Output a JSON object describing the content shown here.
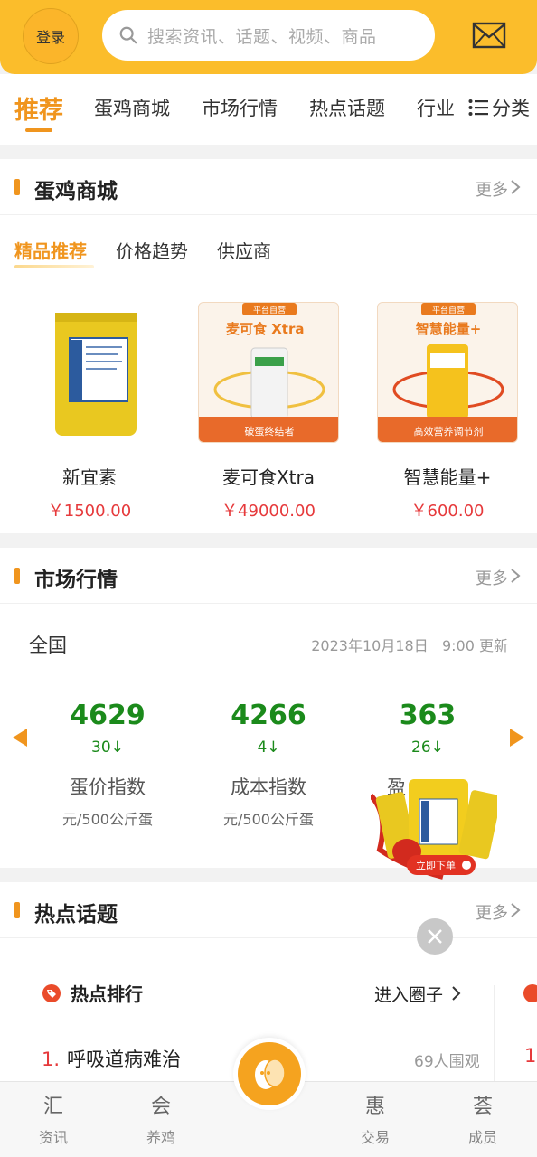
{
  "header": {
    "login_label": "登录",
    "search_placeholder": "搜索资讯、话题、视频、商品"
  },
  "nav": {
    "tabs": [
      "推荐",
      "蛋鸡商城",
      "市场行情",
      "热点话题",
      "行业"
    ],
    "category_label": "分类"
  },
  "mall": {
    "title": "蛋鸡商城",
    "more": "更多",
    "sub_tabs": [
      "精品推荐",
      "价格趋势",
      "供应商"
    ],
    "products": [
      {
        "name": "新宜素",
        "price": "￥1500.00"
      },
      {
        "name": "麦可食Xtra",
        "price": "￥49000.00",
        "badge": "平台自营",
        "caption": "破蛋终结者"
      },
      {
        "name": "智慧能量+",
        "price": "￥600.00",
        "badge": "平台自营",
        "caption": "高效营养调节剂"
      }
    ]
  },
  "market": {
    "title": "市场行情",
    "more": "更多",
    "region": "全国",
    "date": "2023年10月18日",
    "update": "9:00 更新",
    "indices": [
      {
        "value": "4629",
        "change": "30↓",
        "name": "蛋价指数",
        "unit": "元/500公斤蛋"
      },
      {
        "value": "4266",
        "change": "4↓",
        "name": "成本指数",
        "unit": "元/500公斤蛋"
      },
      {
        "value": "363",
        "change": "26↓",
        "name": "盈",
        "unit": ""
      }
    ]
  },
  "hot": {
    "title": "热点话题",
    "more": "更多",
    "ranking_title": "热点排行",
    "enter_circle": "进入圈子",
    "items": [
      {
        "rank": "1.",
        "text": "呼吸道病难治",
        "count": "69人围观"
      }
    ]
  },
  "promo": {
    "button": "立即下单"
  },
  "tabbar": {
    "items": [
      "资讯",
      "养鸡",
      "交易",
      "成员"
    ]
  },
  "colors": {
    "brand": "#fbbd2b",
    "accent": "#f0951e",
    "price": "#e6393b",
    "index": "#1b8a1b"
  }
}
